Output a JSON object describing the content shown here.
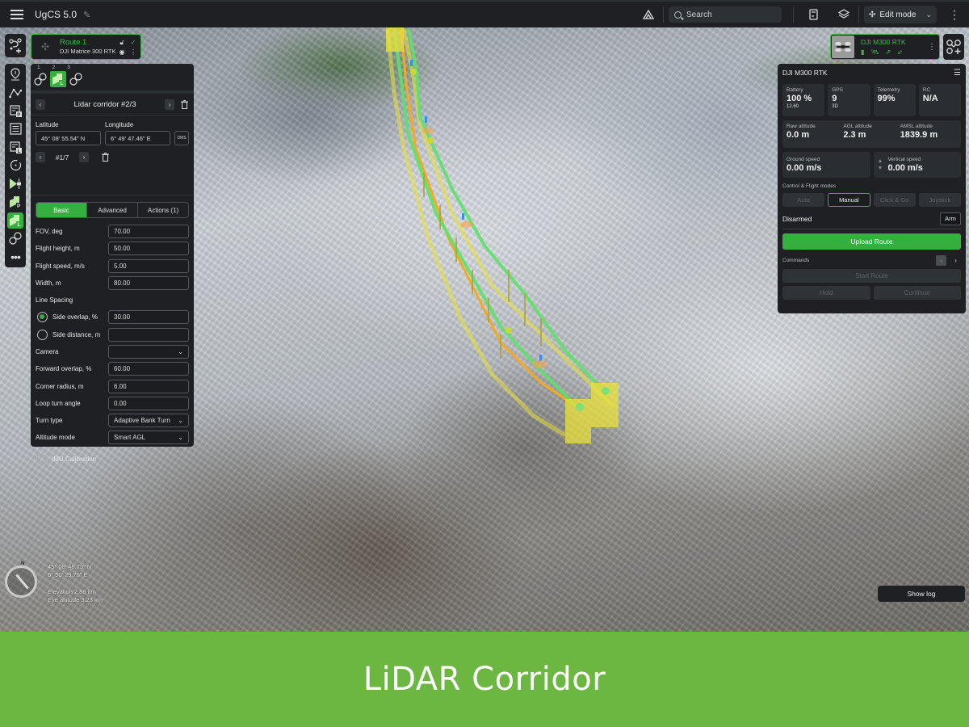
{
  "topbar": {
    "app_title": "UgCS 5.0",
    "search_placeholder": "Search",
    "mode_label": "Edit mode"
  },
  "route_card": {
    "name": "Route 1",
    "vehicle": "DJI Matrice 300 RTK"
  },
  "segments": {
    "numbers": [
      "1",
      "2",
      "3"
    ],
    "active_index": 2
  },
  "segment_nav": {
    "title": "Lidar corridor #2/3"
  },
  "coordinates": {
    "latitude_label": "Latitude",
    "longitude_label": "Longitude",
    "latitude_value": "45° 08' 55.54\" N",
    "longitude_value": "6° 49' 47.46\" E",
    "format_button": "DMS",
    "waypoint_index": "#1/7"
  },
  "tabs": [
    {
      "label": "Basic",
      "active": true
    },
    {
      "label": "Advanced",
      "active": false
    },
    {
      "label": "Actions (1)",
      "active": false
    }
  ],
  "params": {
    "fov": {
      "label": "FOV, deg",
      "value": "70.00"
    },
    "flight_height": {
      "label": "Flight height, m",
      "value": "50.00"
    },
    "flight_speed": {
      "label": "Flight speed, m/s",
      "value": "5.00"
    },
    "width": {
      "label": "Width, m",
      "value": "80.00"
    },
    "line_spacing_label": "Line Spacing",
    "side_overlap": {
      "label": "Side overlap, %",
      "value": "30.00",
      "selected": true
    },
    "side_distance": {
      "label": "Side distance, m",
      "value": "",
      "selected": false
    },
    "camera": {
      "label": "Camera",
      "value": ""
    },
    "forward_overlap": {
      "label": "Forward overlap, %",
      "value": "60.00"
    },
    "corner_radius": {
      "label": "Corner radius, m",
      "value": "6.00"
    },
    "loop_turn_angle": {
      "label": "Loop turn angle",
      "value": "0.00"
    },
    "turn_type": {
      "label": "Turn type",
      "value": "Adaptive Bank Turn"
    },
    "altitude_mode": {
      "label": "Altitude mode",
      "value": "Smart AGL"
    },
    "imu_calibration": {
      "label": "IMU Calibration",
      "checked": false
    }
  },
  "drone_card": {
    "name": "DJI M300 RTK"
  },
  "telemetry": {
    "title": "DJI M300 RTK",
    "battery": {
      "label": "Battery",
      "value": "100 %",
      "sub": "12.60"
    },
    "gps": {
      "label": "GPS",
      "value": "9",
      "sub": "3D"
    },
    "telemetry": {
      "label": "Telemetry",
      "value": "99%"
    },
    "rc": {
      "label": "RC",
      "value": "N/A"
    },
    "raw_altitude": {
      "label": "Raw altitude",
      "value": "0.0 m"
    },
    "agl_altitude": {
      "label": "AGL altitude",
      "value": "2.3 m"
    },
    "amsl_altitude": {
      "label": "AMSL altitude",
      "value": "1839.9 m"
    },
    "ground_speed": {
      "label": "Ground speed",
      "value": "0.00 m/s"
    },
    "vertical_speed": {
      "label": "Vertical speed",
      "value": "0.00 m/s"
    },
    "modes_label": "Control & Flight modes",
    "modes": [
      {
        "label": "Auto",
        "active": false
      },
      {
        "label": "Manual",
        "active": true
      },
      {
        "label": "Click & Go",
        "active": false
      },
      {
        "label": "Joystick",
        "active": false
      }
    ],
    "arm_status": "Disarmed",
    "arm_button": "Arm",
    "upload_button": "Upload Route",
    "commands_label": "Commands",
    "start_route": "Start Route",
    "hold": "Hold",
    "continue": "Continue"
  },
  "map_overlay": {
    "cursor_lat": "45° 08' 46.73\" N",
    "cursor_lon": "6° 50' 29.76\" E",
    "elevation": "Elevation 2.86 km",
    "eye_altitude": "Eye altitude 3.23 km",
    "compass_north": "N"
  },
  "show_log": "Show log",
  "banner": {
    "title": "LiDAR Corridor"
  },
  "colors": {
    "accent_green": "#34b03f",
    "banner_green": "#6bb741",
    "route_green": "#5ee06a",
    "route_yellow": "#e8e23a",
    "route_orange": "#f6a91c"
  }
}
